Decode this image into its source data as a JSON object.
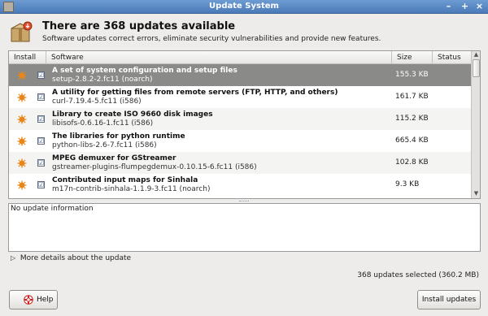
{
  "window": {
    "title": "Update System",
    "controls": {
      "minimize": "–",
      "maximize": "+",
      "close": "×"
    }
  },
  "header": {
    "title": "There are 368 updates available",
    "description": "Software updates correct errors, eliminate security vulnerabilities and provide new features."
  },
  "table": {
    "columns": [
      "Install",
      "Software",
      "Size",
      "Status"
    ],
    "rows": [
      {
        "name": "A set of system configuration and setup files",
        "package": "setup-2.8.2-2.fc11 (noarch)",
        "size": "155.3 KB",
        "checked": "☑"
      },
      {
        "name": "A utility for getting files from remote servers (FTP, HTTP, and others)",
        "package": "curl-7.19.4-5.fc11 (i586)",
        "size": "161.7 KB",
        "checked": "☑"
      },
      {
        "name": "Library to create ISO 9660 disk images",
        "package": "libisofs-0.6.16-1.fc11 (i586)",
        "size": "115.2 KB",
        "checked": "☑"
      },
      {
        "name": "The libraries for python runtime",
        "package": "python-libs-2.6-7.fc11 (i586)",
        "size": "665.4 KB",
        "checked": "☑"
      },
      {
        "name": "MPEG demuxer for GStreamer",
        "package": "gstreamer-plugins-flumpegdemux-0.10.15-6.fc11 (i586)",
        "size": "102.8 KB",
        "checked": "☑"
      },
      {
        "name": "Contributed input maps for Sinhala",
        "package": "m17n-contrib-sinhala-1.1.9-3.fc11 (noarch)",
        "size": "9.3 KB",
        "checked": "☑"
      }
    ]
  },
  "info": {
    "text": "No update information"
  },
  "expander": {
    "label": "More details about the update",
    "arrow": "▷"
  },
  "selection_summary": "368 updates selected (360.2 MB)",
  "buttons": {
    "help": "Help",
    "install": "Install updates"
  },
  "scroll": {
    "up": "▲",
    "down": "▼"
  },
  "colors": {
    "titlebar": "#4a7ab8",
    "selected_row": "#8a8a88",
    "bug_icon": "#e8861a"
  }
}
